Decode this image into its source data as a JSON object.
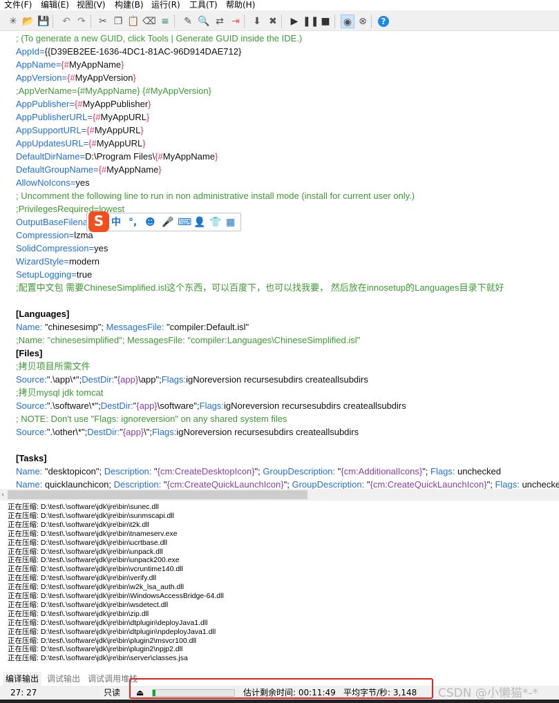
{
  "menu": [
    "文件(F)",
    "编辑(E)",
    "视图(V)",
    "构建(B)",
    "运行(R)",
    "工具(T)",
    "帮助(H)"
  ],
  "toolbar": [
    {
      "icon": "new-file-icon",
      "glyph": "✳"
    },
    {
      "icon": "open-folder-icon",
      "glyph": "📂"
    },
    {
      "icon": "save-icon",
      "glyph": "💾"
    },
    {
      "icon": "undo-icon",
      "glyph": "↶"
    },
    {
      "icon": "redo-icon",
      "glyph": "↷"
    },
    {
      "icon": "cut-icon",
      "glyph": "✂"
    },
    {
      "icon": "copy-icon",
      "glyph": "❐"
    },
    {
      "icon": "paste-icon",
      "glyph": "📋"
    },
    {
      "icon": "eraser-icon",
      "glyph": "⌫"
    },
    {
      "icon": "format-icon",
      "glyph": "≡"
    },
    {
      "icon": "edit-icon",
      "glyph": "✎"
    },
    {
      "icon": "find-icon",
      "glyph": "🔍"
    },
    {
      "icon": "replace-icon",
      "glyph": "⇄"
    },
    {
      "icon": "goto-icon",
      "glyph": "⇥"
    },
    {
      "icon": "compile-icon",
      "glyph": "⬇"
    },
    {
      "icon": "stop-compile-icon",
      "glyph": "✖"
    },
    {
      "icon": "run-icon",
      "glyph": "▶"
    },
    {
      "icon": "pause-icon",
      "glyph": "❚❚"
    },
    {
      "icon": "stop-icon",
      "glyph": "■"
    },
    {
      "icon": "disc-icon",
      "glyph": "◉",
      "pressed": true
    },
    {
      "icon": "disc-cancel-icon",
      "glyph": "⊗"
    },
    {
      "icon": "help-icon",
      "glyph": "?"
    }
  ],
  "code": [
    [
      [
        "c",
        "; (To generate a new GUID, click Tools | Generate GUID inside the IDE.)"
      ]
    ],
    [
      [
        "k",
        "AppId"
      ],
      [
        "k",
        "="
      ],
      [
        "v",
        "{{D39EB2EE-1636-4DC1-81AC-96D914DAE712}"
      ]
    ],
    [
      [
        "k",
        "AppName"
      ],
      [
        "k",
        "="
      ],
      [
        "b",
        "{#"
      ],
      [
        "v",
        "MyAppName"
      ],
      [
        "b",
        "}"
      ]
    ],
    [
      [
        "k",
        "AppVersion"
      ],
      [
        "k",
        "="
      ],
      [
        "b",
        "{#"
      ],
      [
        "v",
        "MyAppVersion"
      ],
      [
        "b",
        "}"
      ]
    ],
    [
      [
        "c",
        ";AppVerName={#MyAppName} {#MyAppVersion}"
      ]
    ],
    [
      [
        "k",
        "AppPublisher"
      ],
      [
        "k",
        "="
      ],
      [
        "b",
        "{#"
      ],
      [
        "v",
        "MyAppPublisher"
      ],
      [
        "b",
        "}"
      ]
    ],
    [
      [
        "k",
        "AppPublisherURL"
      ],
      [
        "k",
        "="
      ],
      [
        "b",
        "{#"
      ],
      [
        "v",
        "MyAppURL"
      ],
      [
        "b",
        "}"
      ]
    ],
    [
      [
        "k",
        "AppSupportURL"
      ],
      [
        "k",
        "="
      ],
      [
        "b",
        "{#"
      ],
      [
        "v",
        "MyAppURL"
      ],
      [
        "b",
        "}"
      ]
    ],
    [
      [
        "k",
        "AppUpdatesURL"
      ],
      [
        "k",
        "="
      ],
      [
        "b",
        "{#"
      ],
      [
        "v",
        "MyAppURL"
      ],
      [
        "b",
        "}"
      ]
    ],
    [
      [
        "k",
        "DefaultDirName"
      ],
      [
        "k",
        "="
      ],
      [
        "v",
        "D:\\Program Files\\"
      ],
      [
        "b",
        "{#"
      ],
      [
        "v",
        "MyAppName"
      ],
      [
        "b",
        "}"
      ]
    ],
    [
      [
        "k",
        "DefaultGroupName"
      ],
      [
        "k",
        "="
      ],
      [
        "b",
        "{#"
      ],
      [
        "v",
        "MyAppName"
      ],
      [
        "b",
        "}"
      ]
    ],
    [
      [
        "k",
        "AllowNoIcons"
      ],
      [
        "k",
        "="
      ],
      [
        "v",
        "yes"
      ]
    ],
    [
      [
        "c",
        "; Uncomment the following line to run in non administrative install mode (install for current user only.)"
      ]
    ],
    [
      [
        "c",
        ";PrivilegesRequired=lowest"
      ]
    ],
    [
      [
        "k",
        "OutputBaseFilena"
      ]
    ],
    [
      [
        "k",
        "Compression"
      ],
      [
        "k",
        "="
      ],
      [
        "v",
        "lzma"
      ]
    ],
    [
      [
        "k",
        "SolidCompression"
      ],
      [
        "k",
        "="
      ],
      [
        "v",
        "yes"
      ]
    ],
    [
      [
        "k",
        "WizardStyle"
      ],
      [
        "k",
        "="
      ],
      [
        "v",
        "modern"
      ]
    ],
    [
      [
        "k",
        "SetupLogging"
      ],
      [
        "k",
        "="
      ],
      [
        "v",
        "true"
      ]
    ],
    [
      [
        "c",
        ";配置中文包 需要ChineseSimplified.isl这个东西，可以百度下，也可以找我要， 然后放在innosetup的Languages目录下就好"
      ]
    ],
    [],
    [
      [
        "s",
        "[Languages]"
      ]
    ],
    [
      [
        "k",
        "Name:"
      ],
      [
        "v",
        " \"chinesesimp\"; "
      ],
      [
        "k",
        "MessagesFile:"
      ],
      [
        "v",
        " \"compiler:Default.isl\""
      ]
    ],
    [
      [
        "c",
        ";Name: \"chinesesimplified\"; MessagesFile: \"compiler:Languages\\ChineseSimplified.isl\""
      ]
    ],
    [
      [
        "s",
        "[Files]"
      ]
    ],
    [
      [
        "c",
        ";拷贝项目所需文件"
      ]
    ],
    [
      [
        "k",
        "Source:"
      ],
      [
        "v",
        "\".\\app\\*\";"
      ],
      [
        "k",
        "DestDir:"
      ],
      [
        "v",
        "\""
      ],
      [
        "p",
        "{app}"
      ],
      [
        "v",
        "\\app\";"
      ],
      [
        "k",
        "Flags:"
      ],
      [
        "v",
        "igNoreversion recursesubdirs createallsubdirs"
      ]
    ],
    [
      [
        "c",
        ";拷贝mysql jdk tomcat"
      ]
    ],
    [
      [
        "k",
        "Source:"
      ],
      [
        "v",
        "\".\\software\\*\";"
      ],
      [
        "k",
        "DestDir:"
      ],
      [
        "v",
        "\""
      ],
      [
        "p",
        "{app}"
      ],
      [
        "v",
        "\\software\";"
      ],
      [
        "k",
        "Flags:"
      ],
      [
        "v",
        "igNoreversion recursesubdirs createallsubdirs"
      ]
    ],
    [
      [
        "c",
        "; NOTE: Don't use \"Flags: ignoreversion\" on any shared system files"
      ]
    ],
    [
      [
        "k",
        "Source:"
      ],
      [
        "v",
        "\".\\other\\*\";"
      ],
      [
        "k",
        "DestDir:"
      ],
      [
        "v",
        "\""
      ],
      [
        "p",
        "{app}"
      ],
      [
        "v",
        "\\\";"
      ],
      [
        "k",
        "Flags:"
      ],
      [
        "v",
        "igNoreversion recursesubdirs createallsubdirs"
      ]
    ],
    [],
    [
      [
        "s",
        "[Tasks]"
      ]
    ],
    [
      [
        "k",
        "Name:"
      ],
      [
        "v",
        " \"desktopicon\"; "
      ],
      [
        "k",
        "Description:"
      ],
      [
        "v",
        " \""
      ],
      [
        "p",
        "{cm:CreateDesktopIcon}"
      ],
      [
        "v",
        "\"; "
      ],
      [
        "k",
        "GroupDescription:"
      ],
      [
        "v",
        " \""
      ],
      [
        "p",
        "{cm:AdditionalIcons}"
      ],
      [
        "v",
        "\"; "
      ],
      [
        "k",
        "Flags:"
      ],
      [
        "v",
        " unchecked"
      ]
    ],
    [
      [
        "k",
        "Name:"
      ],
      [
        "v",
        " quicklaunchicon; "
      ],
      [
        "k",
        "Description:"
      ],
      [
        "v",
        " \""
      ],
      [
        "p",
        "{cm:CreateQuickLaunchIcon}"
      ],
      [
        "v",
        "\"; "
      ],
      [
        "k",
        "GroupDescription:"
      ],
      [
        "v",
        " \""
      ],
      [
        "p",
        "{cm:CreateQuickLaunchIcon}"
      ],
      [
        "v",
        "\"; "
      ],
      [
        "k",
        "Flags:"
      ],
      [
        "v",
        " unchecked"
      ]
    ]
  ],
  "ime": {
    "logo": "S",
    "items": [
      {
        "icon": "chinese-mode-icon",
        "glyph": "中"
      },
      {
        "icon": "punctuation-icon",
        "glyph": "°,"
      },
      {
        "icon": "emoji-icon",
        "glyph": "☻"
      },
      {
        "icon": "microphone-icon",
        "glyph": "🎤"
      },
      {
        "icon": "keyboard-icon",
        "glyph": "⌨"
      },
      {
        "icon": "user-icon",
        "glyph": "👤"
      },
      {
        "icon": "skin-icon",
        "glyph": "👕"
      },
      {
        "icon": "toolbox-icon",
        "glyph": "▦"
      }
    ]
  },
  "output_prefix": "正在压缩: ",
  "output": [
    "D:\\test\\.\\software\\jdk\\jre\\bin\\sunec.dll",
    "D:\\test\\.\\software\\jdk\\jre\\bin\\sunmscapi.dll",
    "D:\\test\\.\\software\\jdk\\jre\\bin\\t2k.dll",
    "D:\\test\\.\\software\\jdk\\jre\\bin\\tnameserv.exe",
    "D:\\test\\.\\software\\jdk\\jre\\bin\\ucrtbase.dll",
    "D:\\test\\.\\software\\jdk\\jre\\bin\\unpack.dll",
    "D:\\test\\.\\software\\jdk\\jre\\bin\\unpack200.exe",
    "D:\\test\\.\\software\\jdk\\jre\\bin\\vcruntime140.dll",
    "D:\\test\\.\\software\\jdk\\jre\\bin\\verify.dll",
    "D:\\test\\.\\software\\jdk\\jre\\bin\\w2k_lsa_auth.dll",
    "D:\\test\\.\\software\\jdk\\jre\\bin\\WindowsAccessBridge-64.dll",
    "D:\\test\\.\\software\\jdk\\jre\\bin\\wsdetect.dll",
    "D:\\test\\.\\software\\jdk\\jre\\bin\\zip.dll",
    "D:\\test\\.\\software\\jdk\\jre\\bin\\dtplugin\\deployJava1.dll",
    "D:\\test\\.\\software\\jdk\\jre\\bin\\dtplugin\\npdeployJava1.dll",
    "D:\\test\\.\\software\\jdk\\jre\\bin\\plugin2\\msvcr100.dll",
    "D:\\test\\.\\software\\jdk\\jre\\bin\\plugin2\\npjp2.dll",
    "D:\\test\\.\\software\\jdk\\jre\\bin\\server\\classes.jsa"
  ],
  "tabs": [
    "编译输出",
    "调试输出",
    "调试调用堆栈"
  ],
  "status": {
    "position": "27:  27",
    "mode": "只读",
    "progress_percent": 3,
    "remaining": "估计剩余时间: 00:11:49",
    "speed": "平均字节/秒: 3,148"
  },
  "watermark": "CSDN @小懒猫*-*",
  "colors": {
    "key": "#1e70d8",
    "comment": "#3c9b32",
    "brace": "#e5356b",
    "constant": "#8b3ea8",
    "progress": "#06b025",
    "highlight_box": "#e8201a"
  }
}
